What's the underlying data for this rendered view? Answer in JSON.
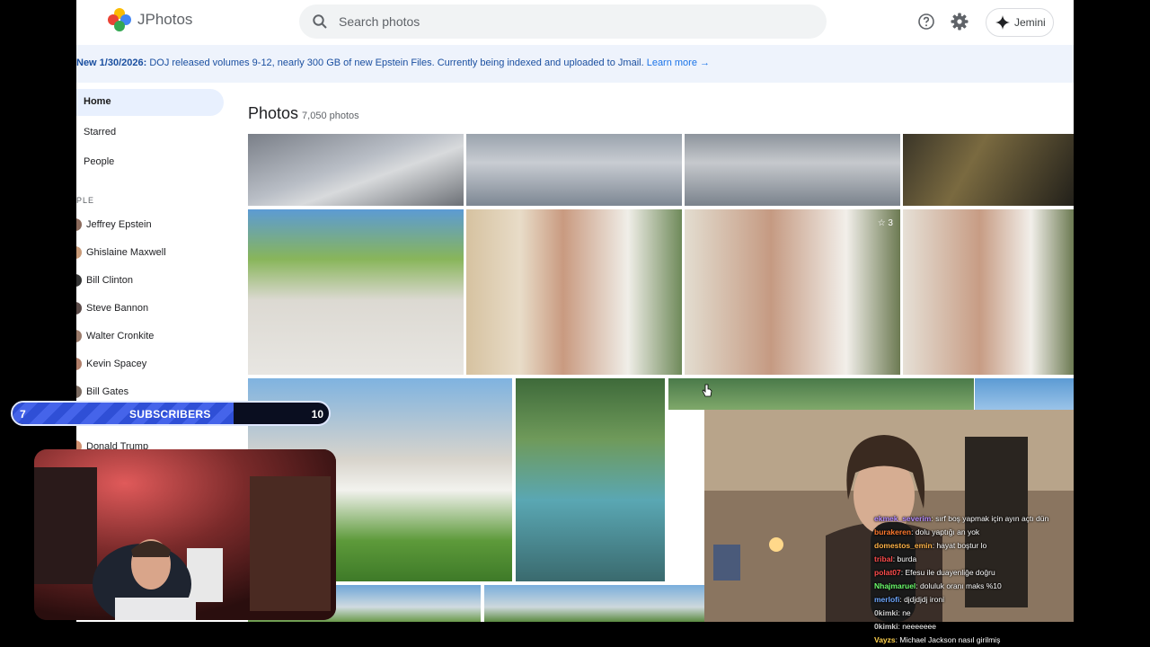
{
  "app": {
    "title": "JPhotos"
  },
  "search": {
    "placeholder": "Search photos"
  },
  "header": {
    "assistant_label": "Jemini"
  },
  "banner": {
    "prefix": "New 1/30/2026:",
    "message": " DOJ released volumes 9-12, nearly 300 GB of new Epstein Files. Currently being indexed and uploaded to Jmail. ",
    "link": "Learn more →"
  },
  "sidebar": {
    "items": [
      {
        "label": "Home",
        "active": true
      },
      {
        "label": "Starred"
      },
      {
        "label": "People"
      }
    ],
    "section_label": "PLE",
    "people": [
      "Jeffrey Epstein",
      "Ghislaine Maxwell",
      "Bill Clinton",
      "Steve Bannon",
      "Walter Cronkite",
      "Kevin Spacey",
      "Bill Gates",
      "Donald Trump"
    ]
  },
  "main": {
    "title": "Photos",
    "count": "7,050 photos",
    "favorite_badge": "☆ 3"
  },
  "overlay": {
    "subscribers": {
      "label": "SUBSCRIBERS",
      "start": "7",
      "goal": "10",
      "progress": 0.7
    },
    "chat": [
      {
        "user": "ekmek_severim",
        "msg": ": sırf boş yapmak için ayın açtı dün",
        "color": "#b58cff"
      },
      {
        "user": "burakeren",
        "msg": ": dolu yaptığı an yok",
        "color": "#ff7a2e"
      },
      {
        "user": "domestos_emin",
        "msg": ": hayat boştur lo",
        "color": "#ffb347"
      },
      {
        "user": "tribal",
        "msg": ": burda",
        "color": "#ff4d4d"
      },
      {
        "user": "polat07",
        "msg": ": Efesu ile duayenliğe doğru",
        "color": "#ff4d4d"
      },
      {
        "user": "Nhajmaruel",
        "msg": ": doluluk oranı maks %10",
        "color": "#6dff6d"
      },
      {
        "user": "merlofi",
        "msg": ": djdjdjdj ironi",
        "color": "#6fa8ff"
      },
      {
        "user": "0kimki",
        "msg": ": ne",
        "color": "#d0d0d0"
      },
      {
        "user": "0kimki",
        "msg": ": neeeeeee",
        "color": "#d0d0d0"
      },
      {
        "user": "Vayzs",
        "msg": ": Michael Jackson nasıl girilmiş",
        "color": "#ffd24d"
      }
    ]
  },
  "colors": {
    "accent": "#1a73e8",
    "banner_bg": "#eef3fc",
    "nav_active_bg": "#e8f0fe",
    "subscriber_fill": "#3b5bdb"
  }
}
